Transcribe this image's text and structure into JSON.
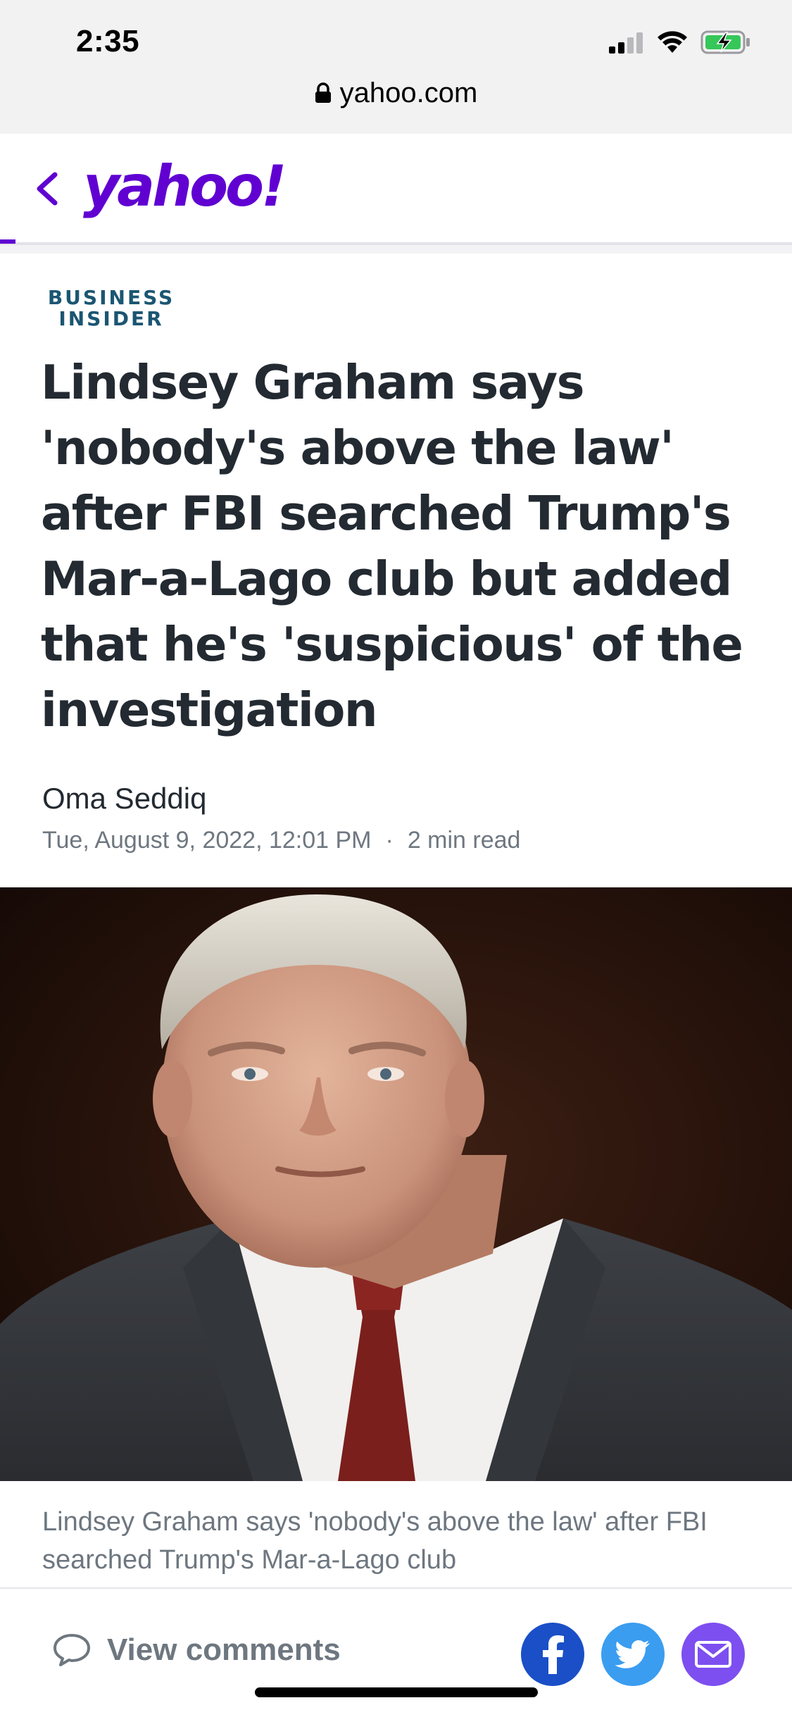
{
  "status_bar": {
    "time": "2:35"
  },
  "browser": {
    "url": "yahoo.com"
  },
  "header": {
    "logo_text": "yahoo!",
    "accent_color": "#6001d2"
  },
  "article": {
    "publisher_line1": "BUSINESS",
    "publisher_line2": "INSIDER",
    "headline": "Lindsey Graham says 'nobody's above the law' after FBI searched Trump's Mar-a-Lago club but added that he's 'suspicious' of the investigation",
    "author": "Oma Seddiq",
    "date": "Tue, August 9, 2022, 12:01 PM",
    "separator": "·",
    "read_time": "2 min read",
    "caption": "Lindsey Graham says 'nobody's above the law' after FBI searched Trump's Mar-a-Lago club"
  },
  "bottom_bar": {
    "comments_label": "View comments",
    "share_icons": [
      "facebook-icon",
      "twitter-icon",
      "mail-icon"
    ]
  }
}
